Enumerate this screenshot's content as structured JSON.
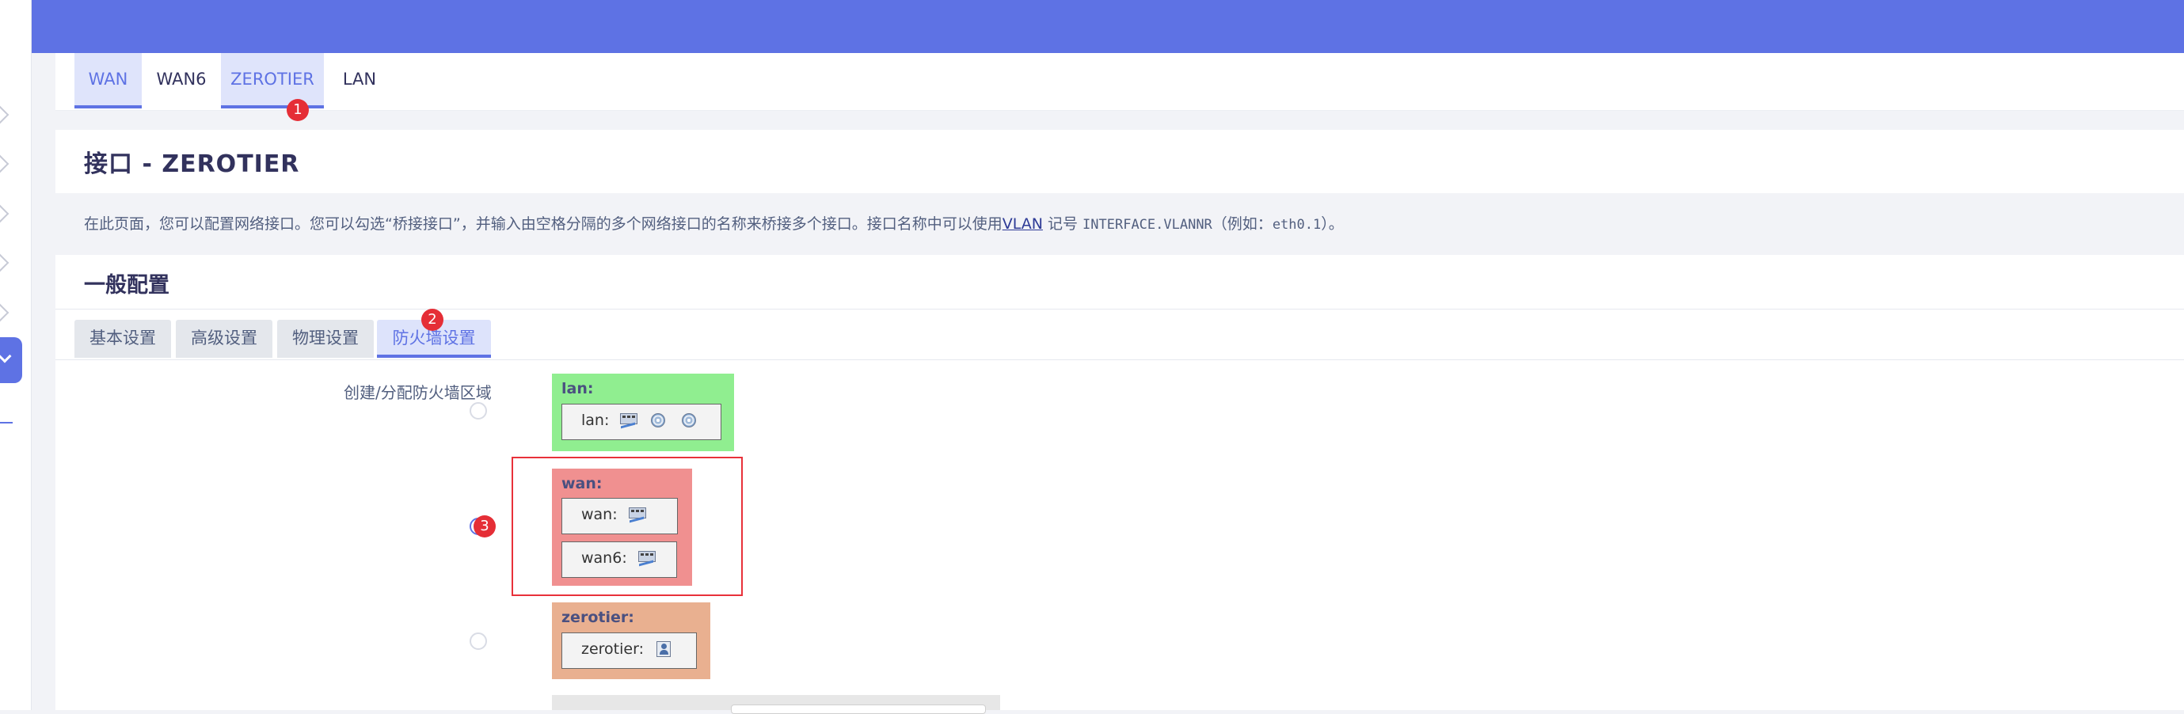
{
  "colors": {
    "accent": "#5e72e4",
    "lan_zone": "#90ee90",
    "wan_zone": "#f09090",
    "zerotier_zone": "#e9b090",
    "badge": "#e52e36"
  },
  "interface_tabs": [
    {
      "label": "WAN",
      "selected": true
    },
    {
      "label": "WAN6",
      "selected": false
    },
    {
      "label": "ZEROTIER",
      "selected": true
    },
    {
      "label": "LAN",
      "selected": false
    }
  ],
  "page_title": "接口 - ZEROTIER",
  "description": {
    "part1": "在此页面，您可以配置网络接口。您可以勾选“桥接接口”，并输入由空格分隔的多个网络接口的名称来桥接多个接口。接口名称中可以使用",
    "vlan_link": "VLAN",
    "part2": " 记号 ",
    "notation": "INTERFACE.VLANNR",
    "part3": "（例如：",
    "example": "eth0.1",
    "part4": "）。"
  },
  "section_title": "一般配置",
  "settings_tabs": [
    {
      "label": "基本设置",
      "selected": false
    },
    {
      "label": "高级设置",
      "selected": false
    },
    {
      "label": "物理设置",
      "selected": false
    },
    {
      "label": "防火墙设置",
      "selected": true
    }
  ],
  "firewall": {
    "field_label": "创建/分配防火墙区域",
    "zones": [
      {
        "name": "lan:",
        "checked": false,
        "interfaces": [
          {
            "label": "lan:",
            "icons": [
              "network-icon",
              "wifi-icon",
              "wifi-icon"
            ]
          }
        ]
      },
      {
        "name": "wan:",
        "checked": true,
        "interfaces": [
          {
            "label": "wan:",
            "icons": [
              "network-icon"
            ]
          },
          {
            "label": "wan6:",
            "icons": [
              "network-icon"
            ]
          }
        ]
      },
      {
        "name": "zerotier:",
        "checked": false,
        "interfaces": [
          {
            "label": "zerotier:",
            "icons": [
              "tunnel-icon"
            ]
          }
        ]
      }
    ]
  },
  "annotations": [
    "1",
    "2",
    "3"
  ]
}
